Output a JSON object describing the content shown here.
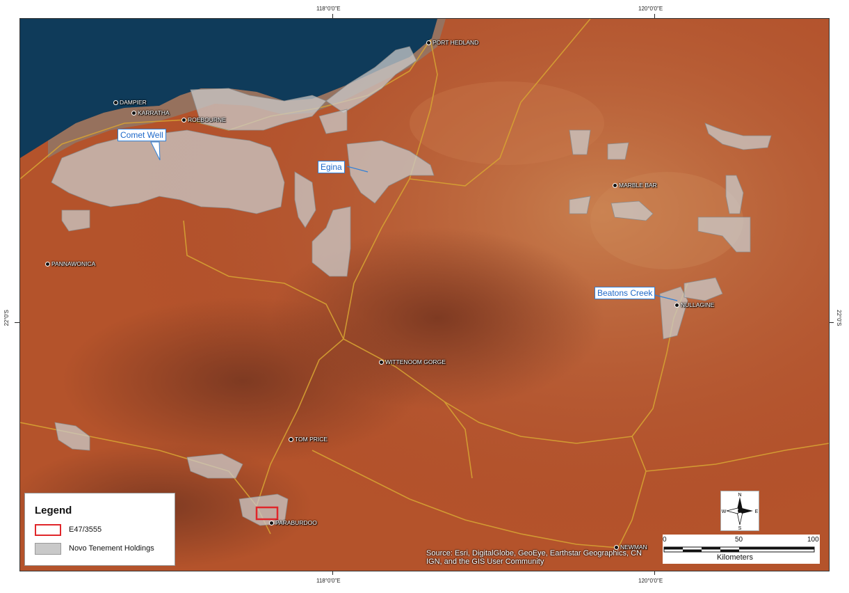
{
  "graticule": {
    "top_left": "118°0'0\"E",
    "top_right": "120°0'0\"E",
    "bottom_left": "118°0'0\"E",
    "bottom_right": "120°0'0\"E",
    "left": "22°0'S",
    "right": "22°0'S"
  },
  "towns": [
    {
      "key": "port_hedland",
      "name": "PORT HEDLAND"
    },
    {
      "key": "dampier",
      "name": "DAMPIER"
    },
    {
      "key": "karratha",
      "name": "KARRATHA"
    },
    {
      "key": "roebourne",
      "name": "ROEBOURNE"
    },
    {
      "key": "marble_bar",
      "name": "MARBLE BAR"
    },
    {
      "key": "pannawonica",
      "name": "PANNAWONICA"
    },
    {
      "key": "nullagine",
      "name": "NULLAGINE"
    },
    {
      "key": "wittenoom",
      "name": "WITTENOOM GORGE"
    },
    {
      "key": "tom_price",
      "name": "TOM PRICE"
    },
    {
      "key": "paraburdoo",
      "name": "PARABURDOO"
    },
    {
      "key": "newman",
      "name": "NEWMAN"
    }
  ],
  "projects": {
    "comet_well": "Comet Well",
    "egina": "Egina",
    "beatons_creek": "Beatons Creek"
  },
  "legend": {
    "title": "Legend",
    "items": [
      {
        "label": "E47/3555",
        "color": "#e0262a"
      },
      {
        "label": "Novo Tenement Holdings",
        "color": "#c9c9c9"
      }
    ]
  },
  "source": {
    "line1": "Source: Esri, DigitalGlobe, GeoEye, Earthstar Geographics, CN",
    "line2": "IGN, and the GIS User Community"
  },
  "north_arrow": {
    "n": "N",
    "s": "S",
    "e": "E",
    "w": "W"
  },
  "scale": {
    "ticks": [
      "0",
      "50",
      "100"
    ],
    "unit": "Kilometers"
  },
  "colors": {
    "ocean": "#0f3b5a",
    "land": "#b5552c",
    "road": "#d6a233",
    "tenement": "#c9c9c9",
    "callout_border": "#2f7fd6"
  }
}
